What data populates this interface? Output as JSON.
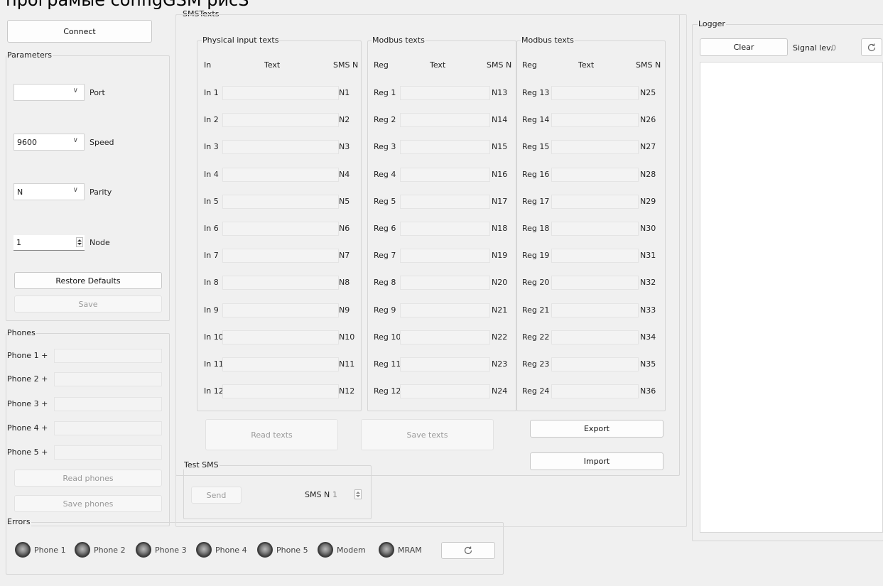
{
  "window_title": "програмые configGSM рисS",
  "connect_label": "Connect",
  "parameters": {
    "title": "Parameters",
    "port": {
      "value": "",
      "label": "Port"
    },
    "speed": {
      "value": "9600",
      "label": "Speed"
    },
    "parity": {
      "value": "N",
      "label": "Parity"
    },
    "node": {
      "value": "1",
      "label": "Node"
    },
    "restore_label": "Restore Defaults",
    "save_label": "Save"
  },
  "phones": {
    "title": "Phones",
    "labels": [
      "Phone 1 +",
      "Phone 2 +",
      "Phone 3 +",
      "Phone 4 +",
      "Phone 5 +"
    ],
    "read_label": "Read phones",
    "save_label": "Save phones"
  },
  "errors": {
    "title": "Errors",
    "leds": [
      "Phone 1",
      "Phone 2",
      "Phone 3",
      "Phone 4",
      "Phone 5",
      "Modem",
      "MRAM"
    ]
  },
  "sms_texts": {
    "title": "SMSTexts",
    "physical": {
      "title": "Physical input texts",
      "headers": [
        "In",
        "Text",
        "SMS N"
      ],
      "rows": [
        [
          "In 1",
          "N1"
        ],
        [
          "In 2",
          "N2"
        ],
        [
          "In 3",
          "N3"
        ],
        [
          "In 4",
          "N4"
        ],
        [
          "In 5",
          "N5"
        ],
        [
          "In 6",
          "N6"
        ],
        [
          "In 7",
          "N7"
        ],
        [
          "In 8",
          "N8"
        ],
        [
          "In 9",
          "N9"
        ],
        [
          "In 10",
          "N10"
        ],
        [
          "In 11",
          "N11"
        ],
        [
          "In 12",
          "N12"
        ]
      ]
    },
    "modbus1": {
      "title": "Modbus texts",
      "headers": [
        "Reg",
        "Text",
        "SMS N"
      ],
      "rows": [
        [
          "Reg 1",
          "N13"
        ],
        [
          "Reg 2",
          "N14"
        ],
        [
          "Reg 3",
          "N15"
        ],
        [
          "Reg 4",
          "N16"
        ],
        [
          "Reg 5",
          "N17"
        ],
        [
          "Reg 6",
          "N18"
        ],
        [
          "Reg 7",
          "N19"
        ],
        [
          "Reg 8",
          "N20"
        ],
        [
          "Reg 9",
          "N21"
        ],
        [
          "Reg 10",
          "N22"
        ],
        [
          "Reg 11",
          "N23"
        ],
        [
          "Reg 12",
          "N24"
        ]
      ]
    },
    "modbus2": {
      "title": "Modbus texts",
      "headers": [
        "Reg",
        "Text",
        "SMS N"
      ],
      "rows": [
        [
          "Reg 13",
          "N25"
        ],
        [
          "Reg 14",
          "N26"
        ],
        [
          "Reg 15",
          "N27"
        ],
        [
          "Reg 16",
          "N28"
        ],
        [
          "Reg 17",
          "N29"
        ],
        [
          "Reg 18",
          "N30"
        ],
        [
          "Reg 19",
          "N31"
        ],
        [
          "Reg 20",
          "N32"
        ],
        [
          "Reg 21",
          "N33"
        ],
        [
          "Reg 22",
          "N34"
        ],
        [
          "Reg 23",
          "N35"
        ],
        [
          "Reg 24",
          "N36"
        ]
      ]
    },
    "read_label": "Read texts",
    "save_label": "Save texts",
    "export_label": "Export",
    "import_label": "Import"
  },
  "test_sms": {
    "title": "Test SMS",
    "send_label": "Send",
    "smsn_label": "SMS N",
    "smsn_value": "1"
  },
  "logger": {
    "title": "Logger",
    "clear_label": "Clear",
    "signal_label": "Signal lev.",
    "signal_value": "0"
  },
  "icons": {
    "refresh": "refresh-icon",
    "dropdown": "chevron-down-icon",
    "spin": "spin-arrows-icon",
    "led": "led-indicator-icon"
  }
}
